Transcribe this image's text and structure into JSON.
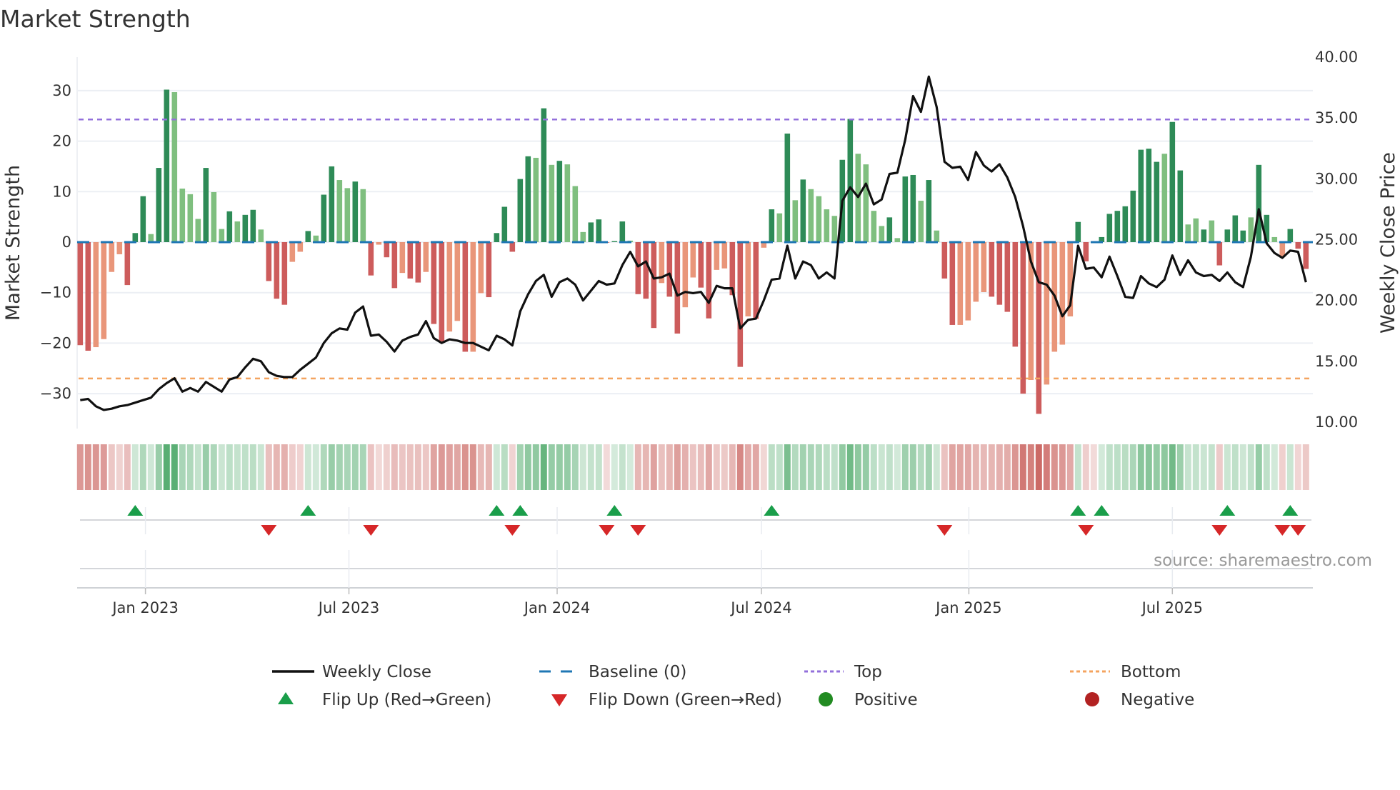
{
  "title": "Market Strength",
  "source": "source: sharemaestro.com",
  "legend": {
    "weekly_close": "Weekly Close",
    "baseline": "Baseline (0)",
    "top": "Top",
    "bottom": "Bottom",
    "flip_up": "Flip Up (Red→Green)",
    "flip_down": "Flip Down (Green→Red)",
    "positive": "Positive",
    "negative": "Negative"
  },
  "colors": {
    "strong_positive": "#2e8b57",
    "weak_positive": "#7fbf7f",
    "strong_negative": "#cd5c5c",
    "weak_negative": "#e9967a",
    "price_line": "#111111",
    "baseline": "#1f77b4",
    "top": "#9370db",
    "bottom": "#f4a460",
    "flip_up": "#1a9e4a",
    "flip_down": "#d62728",
    "positive": "#228b22",
    "negative": "#b22222"
  },
  "chart_data": {
    "type": "bar",
    "title": "Market Strength",
    "ylabel": "Market Strength",
    "y2label": "Weekly Close Price",
    "ylim": [
      -35,
      37
    ],
    "y2lim": [
      10,
      40
    ],
    "yticks": [
      "30",
      "20",
      "10",
      "0",
      "−10",
      "−20",
      "−30"
    ],
    "ytick_values": [
      30,
      20,
      10,
      0,
      -10,
      -20,
      -30
    ],
    "y2ticks": [
      "40.00",
      "35.00",
      "30.00",
      "25.00",
      "20.00",
      "15.00",
      "10.00"
    ],
    "y2tick_values": [
      40,
      35,
      30,
      25,
      20,
      15,
      10
    ],
    "xticks": [
      {
        "label": "Jan 2023",
        "week": 8.3
      },
      {
        "label": "Jul 2023",
        "week": 34.2
      },
      {
        "label": "Jan 2024",
        "week": 60.7
      },
      {
        "label": "Jul 2024",
        "week": 86.7
      },
      {
        "label": "Jan 2025",
        "week": 113.1
      },
      {
        "label": "Jul 2025",
        "week": 139.0
      }
    ],
    "top_level": 24.3,
    "bottom_level": -27.0,
    "baseline": 0,
    "strength": [
      -20.4,
      -21.5,
      -20.8,
      -19.2,
      -5.9,
      -2.4,
      -8.5,
      1.8,
      9.1,
      1.6,
      14.7,
      30.2,
      29.7,
      10.6,
      9.5,
      4.6,
      14.7,
      9.9,
      2.6,
      6.1,
      4.1,
      5.4,
      6.4,
      2.5,
      -7.7,
      -11.2,
      -12.4,
      -3.9,
      -1.9,
      2.2,
      1.3,
      9.4,
      15.0,
      12.3,
      10.7,
      12.0,
      10.5,
      -6.6,
      -0.5,
      -3.0,
      -9.1,
      -6.1,
      -7.2,
      -8.0,
      -5.9,
      -16.2,
      -19.7,
      -17.7,
      -15.6,
      -21.7,
      -21.7,
      -10.1,
      -10.9,
      1.8,
      7.0,
      -1.9,
      12.5,
      17.0,
      16.7,
      26.5,
      15.3,
      16.1,
      15.4,
      11.1,
      2.0,
      3.9,
      4.5,
      -0.1,
      0.2,
      4.1,
      0.3,
      -10.3,
      -11.2,
      -17.0,
      -8.1,
      -10.8,
      -18.1,
      -12.9,
      -7.0,
      -9.0,
      -15.1,
      -5.5,
      -5.2,
      -10.5,
      -24.7,
      -14.7,
      -15.2,
      -1.1,
      6.5,
      5.7,
      21.5,
      8.3,
      12.4,
      10.5,
      9.1,
      6.5,
      5.2,
      16.3,
      24.4,
      17.5,
      15.4,
      6.2,
      3.2,
      4.9,
      0.8,
      13.0,
      13.3,
      8.2,
      12.3,
      2.3,
      -7.2,
      -16.4,
      -16.4,
      -15.5,
      -11.8,
      -9.9,
      -10.8,
      -12.4,
      -13.8,
      -20.7,
      -30.0,
      -27.3,
      -34.0,
      -28.2,
      -21.7,
      -20.3,
      -14.7,
      4.0,
      -3.8,
      -0.1,
      1.0,
      5.6,
      6.2,
      7.1,
      10.2,
      18.3,
      18.5,
      15.9,
      17.5,
      23.8,
      14.2,
      3.5,
      4.7,
      2.5,
      4.3,
      -4.6,
      2.5,
      5.3,
      2.3,
      4.9,
      15.3,
      5.4,
      1.0,
      -3.0,
      2.6,
      -1.3,
      -5.3
    ],
    "shade": "DDLLLLDDDLDDLLLLDLLDLDDLDDDLLDLDDLLDLDLDDLDDLDDLLDLLDDDDDDLDLDLLLDDDDDLDDDLDDLLDDLLDDLDLDLDLDLLLLDDLLLLDLDDLDLDDLLLLDDDDDLDLLLLDDDDDDDDDDDLDDLLDLDDDDLDDLLDDDD",
    "weekly_close": [
      11.8,
      11.9,
      11.3,
      11.0,
      11.1,
      11.3,
      11.4,
      11.6,
      11.8,
      12.0,
      12.7,
      13.2,
      13.6,
      12.5,
      12.8,
      12.5,
      13.3,
      12.9,
      12.5,
      13.5,
      13.7,
      14.5,
      15.2,
      15.0,
      14.1,
      13.8,
      13.7,
      13.7,
      14.3,
      14.8,
      15.3,
      16.5,
      17.3,
      17.7,
      17.6,
      19.0,
      19.5,
      17.1,
      17.2,
      16.6,
      15.8,
      16.7,
      17.0,
      17.2,
      18.3,
      16.9,
      16.5,
      16.8,
      16.7,
      16.5,
      16.5,
      16.2,
      15.9,
      17.1,
      16.8,
      16.3,
      19.1,
      20.5,
      21.6,
      22.1,
      20.3,
      21.5,
      21.8,
      21.3,
      20.0,
      20.8,
      21.6,
      21.3,
      21.4,
      22.9,
      24.0,
      22.8,
      23.2,
      21.8,
      21.9,
      22.2,
      20.4,
      20.7,
      20.6,
      20.7,
      19.8,
      21.2,
      21.0,
      21.0,
      17.7,
      18.4,
      18.5,
      20.0,
      21.7,
      21.8,
      24.5,
      21.8,
      23.2,
      22.9,
      21.8,
      22.3,
      21.8,
      28.2,
      29.3,
      28.5,
      29.6,
      27.9,
      28.3,
      30.4,
      30.5,
      33.2,
      36.8,
      35.5,
      38.4,
      35.9,
      31.4,
      30.9,
      31.0,
      29.9,
      32.2,
      31.1,
      30.6,
      31.2,
      30.1,
      28.5,
      26.1,
      23.2,
      21.5,
      21.3,
      20.4,
      18.7,
      19.6,
      24.5,
      22.6,
      22.7,
      21.9,
      23.6,
      22.0,
      20.3,
      20.2,
      22.0,
      21.4,
      21.1,
      21.7,
      23.7,
      22.1,
      23.3,
      22.3,
      22.0,
      22.1,
      21.6,
      22.3,
      21.5,
      21.1,
      23.6,
      27.5,
      24.7,
      23.9,
      23.5,
      24.1,
      24.0,
      21.5
    ],
    "flip_up_weeks": [
      7,
      29,
      53,
      56,
      68,
      88,
      127,
      130,
      146,
      154
    ],
    "flip_down_weeks": [
      24,
      37,
      55,
      67,
      71,
      110,
      128,
      145,
      153,
      155
    ],
    "legend_placement": "bottom-center",
    "grid": true
  }
}
